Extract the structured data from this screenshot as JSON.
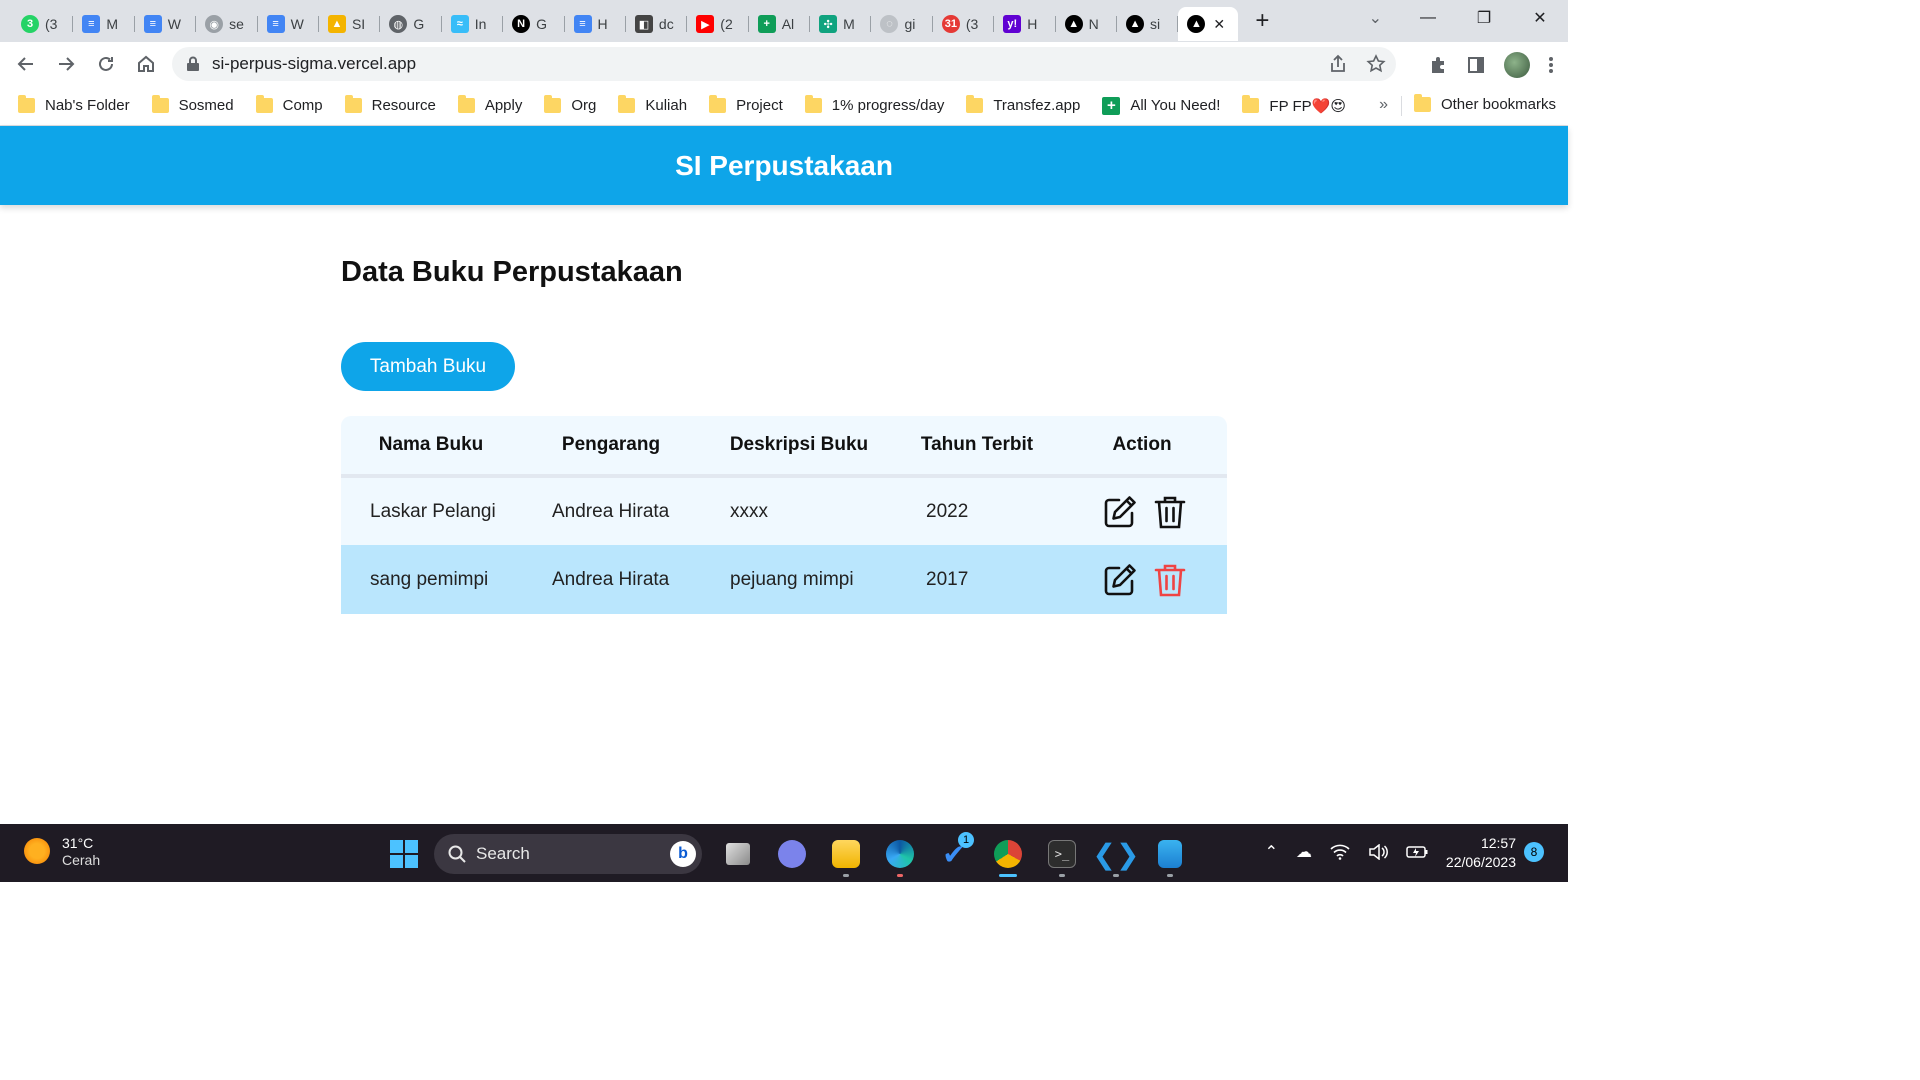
{
  "browser": {
    "tabs": [
      {
        "label": "(3",
        "icon": "whatsapp-icon",
        "color": "#25d366",
        "glyph": "3",
        "round": true
      },
      {
        "label": "M",
        "icon": "google-docs-icon",
        "color": "#4285f4",
        "glyph": "≡"
      },
      {
        "label": "W",
        "icon": "google-docs-icon",
        "color": "#4285f4",
        "glyph": "≡"
      },
      {
        "label": "se",
        "icon": "github-icon",
        "color": "#9aa0a6",
        "glyph": "◉",
        "round": true
      },
      {
        "label": "W",
        "icon": "google-docs-icon",
        "color": "#4285f4",
        "glyph": "≡"
      },
      {
        "label": "SI",
        "icon": "drive-icon",
        "color": "#f4b400",
        "glyph": "▲"
      },
      {
        "label": "G",
        "icon": "globe-icon",
        "color": "#5f6368",
        "glyph": "◍",
        "round": true
      },
      {
        "label": "In",
        "icon": "tailwind-icon",
        "color": "#38bdf8",
        "glyph": "≈"
      },
      {
        "label": "G",
        "icon": "notion-icon",
        "color": "#000000",
        "glyph": "N",
        "round": true
      },
      {
        "label": "H",
        "icon": "google-docs-icon",
        "color": "#4285f4",
        "glyph": "≡"
      },
      {
        "label": "dc",
        "icon": "notion-page-icon",
        "color": "#444444",
        "glyph": "◧"
      },
      {
        "label": "(2",
        "icon": "youtube-icon",
        "color": "#ff0000",
        "glyph": "▶"
      },
      {
        "label": "Al",
        "icon": "google-sheets-icon",
        "color": "#0f9d58",
        "glyph": "+"
      },
      {
        "label": "M",
        "icon": "chatgpt-icon",
        "color": "#10a37f",
        "glyph": "✣"
      },
      {
        "label": "gi",
        "icon": "loading-icon",
        "color": "#bdc1c6",
        "glyph": "◌",
        "round": true
      },
      {
        "label": "(3",
        "icon": "calendar-icon",
        "color": "#e53935",
        "glyph": "31",
        "round": true
      },
      {
        "label": "H",
        "icon": "yahoo-icon",
        "color": "#6001d2",
        "glyph": "y!"
      },
      {
        "label": "N",
        "icon": "vercel-icon",
        "color": "#000000",
        "glyph": "▲",
        "round": true
      },
      {
        "label": "si",
        "icon": "vercel-icon",
        "color": "#000000",
        "glyph": "▲",
        "round": true
      }
    ],
    "active_tab": {
      "icon": "vercel-icon",
      "glyph": "▲",
      "close": "✕"
    },
    "new_tab": "+",
    "tab_search": "⌄",
    "window_controls": {
      "minimize": "—",
      "restore": "❐",
      "close": "✕"
    },
    "url": "si-perpus-sigma.vercel.app",
    "bookmarks": [
      {
        "label": "Nab's Folder",
        "icon": "folder-icon"
      },
      {
        "label": "Sosmed",
        "icon": "folder-icon"
      },
      {
        "label": "Comp",
        "icon": "folder-icon"
      },
      {
        "label": "Resource",
        "icon": "folder-icon"
      },
      {
        "label": "Apply",
        "icon": "folder-icon"
      },
      {
        "label": "Org",
        "icon": "folder-icon"
      },
      {
        "label": "Kuliah",
        "icon": "folder-icon"
      },
      {
        "label": "Project",
        "icon": "folder-icon"
      },
      {
        "label": "1% progress/day",
        "icon": "folder-icon"
      },
      {
        "label": "Transfez.app",
        "icon": "folder-icon"
      },
      {
        "label": "All You Need!",
        "icon": "google-sheets-icon"
      },
      {
        "label": "FP FP❤️😍",
        "icon": "folder-icon"
      }
    ],
    "bookmarks_more": "»",
    "other_bookmarks": "Other bookmarks"
  },
  "app": {
    "title": "SI Perpustakaan",
    "heading": "Data Buku Perpustakaan",
    "add_button": "Tambah Buku",
    "columns": [
      "Nama Buku",
      "Pengarang",
      "Deskripsi Buku",
      "Tahun Terbit",
      "Action"
    ],
    "rows": [
      {
        "nama": "Laskar Pelangi",
        "pengarang": "Andrea Hirata",
        "deskripsi": "xxxx",
        "tahun": "2022",
        "delete_color": "#111111"
      },
      {
        "nama": "sang pemimpi",
        "pengarang": "Andrea Hirata",
        "deskripsi": "pejuang mimpi",
        "tahun": "2017",
        "delete_color": "#ef4444"
      }
    ],
    "colors": {
      "primary": "#0ea5e9",
      "row_light": "#f0f9ff",
      "row_hover": "#bae6fd",
      "danger": "#ef4444"
    }
  },
  "taskbar": {
    "temperature": "31°C",
    "weather": "Cerah",
    "search_placeholder": "Search",
    "time": "12:57",
    "date": "22/06/2023",
    "notifications": "8",
    "todo_badge": "1"
  }
}
